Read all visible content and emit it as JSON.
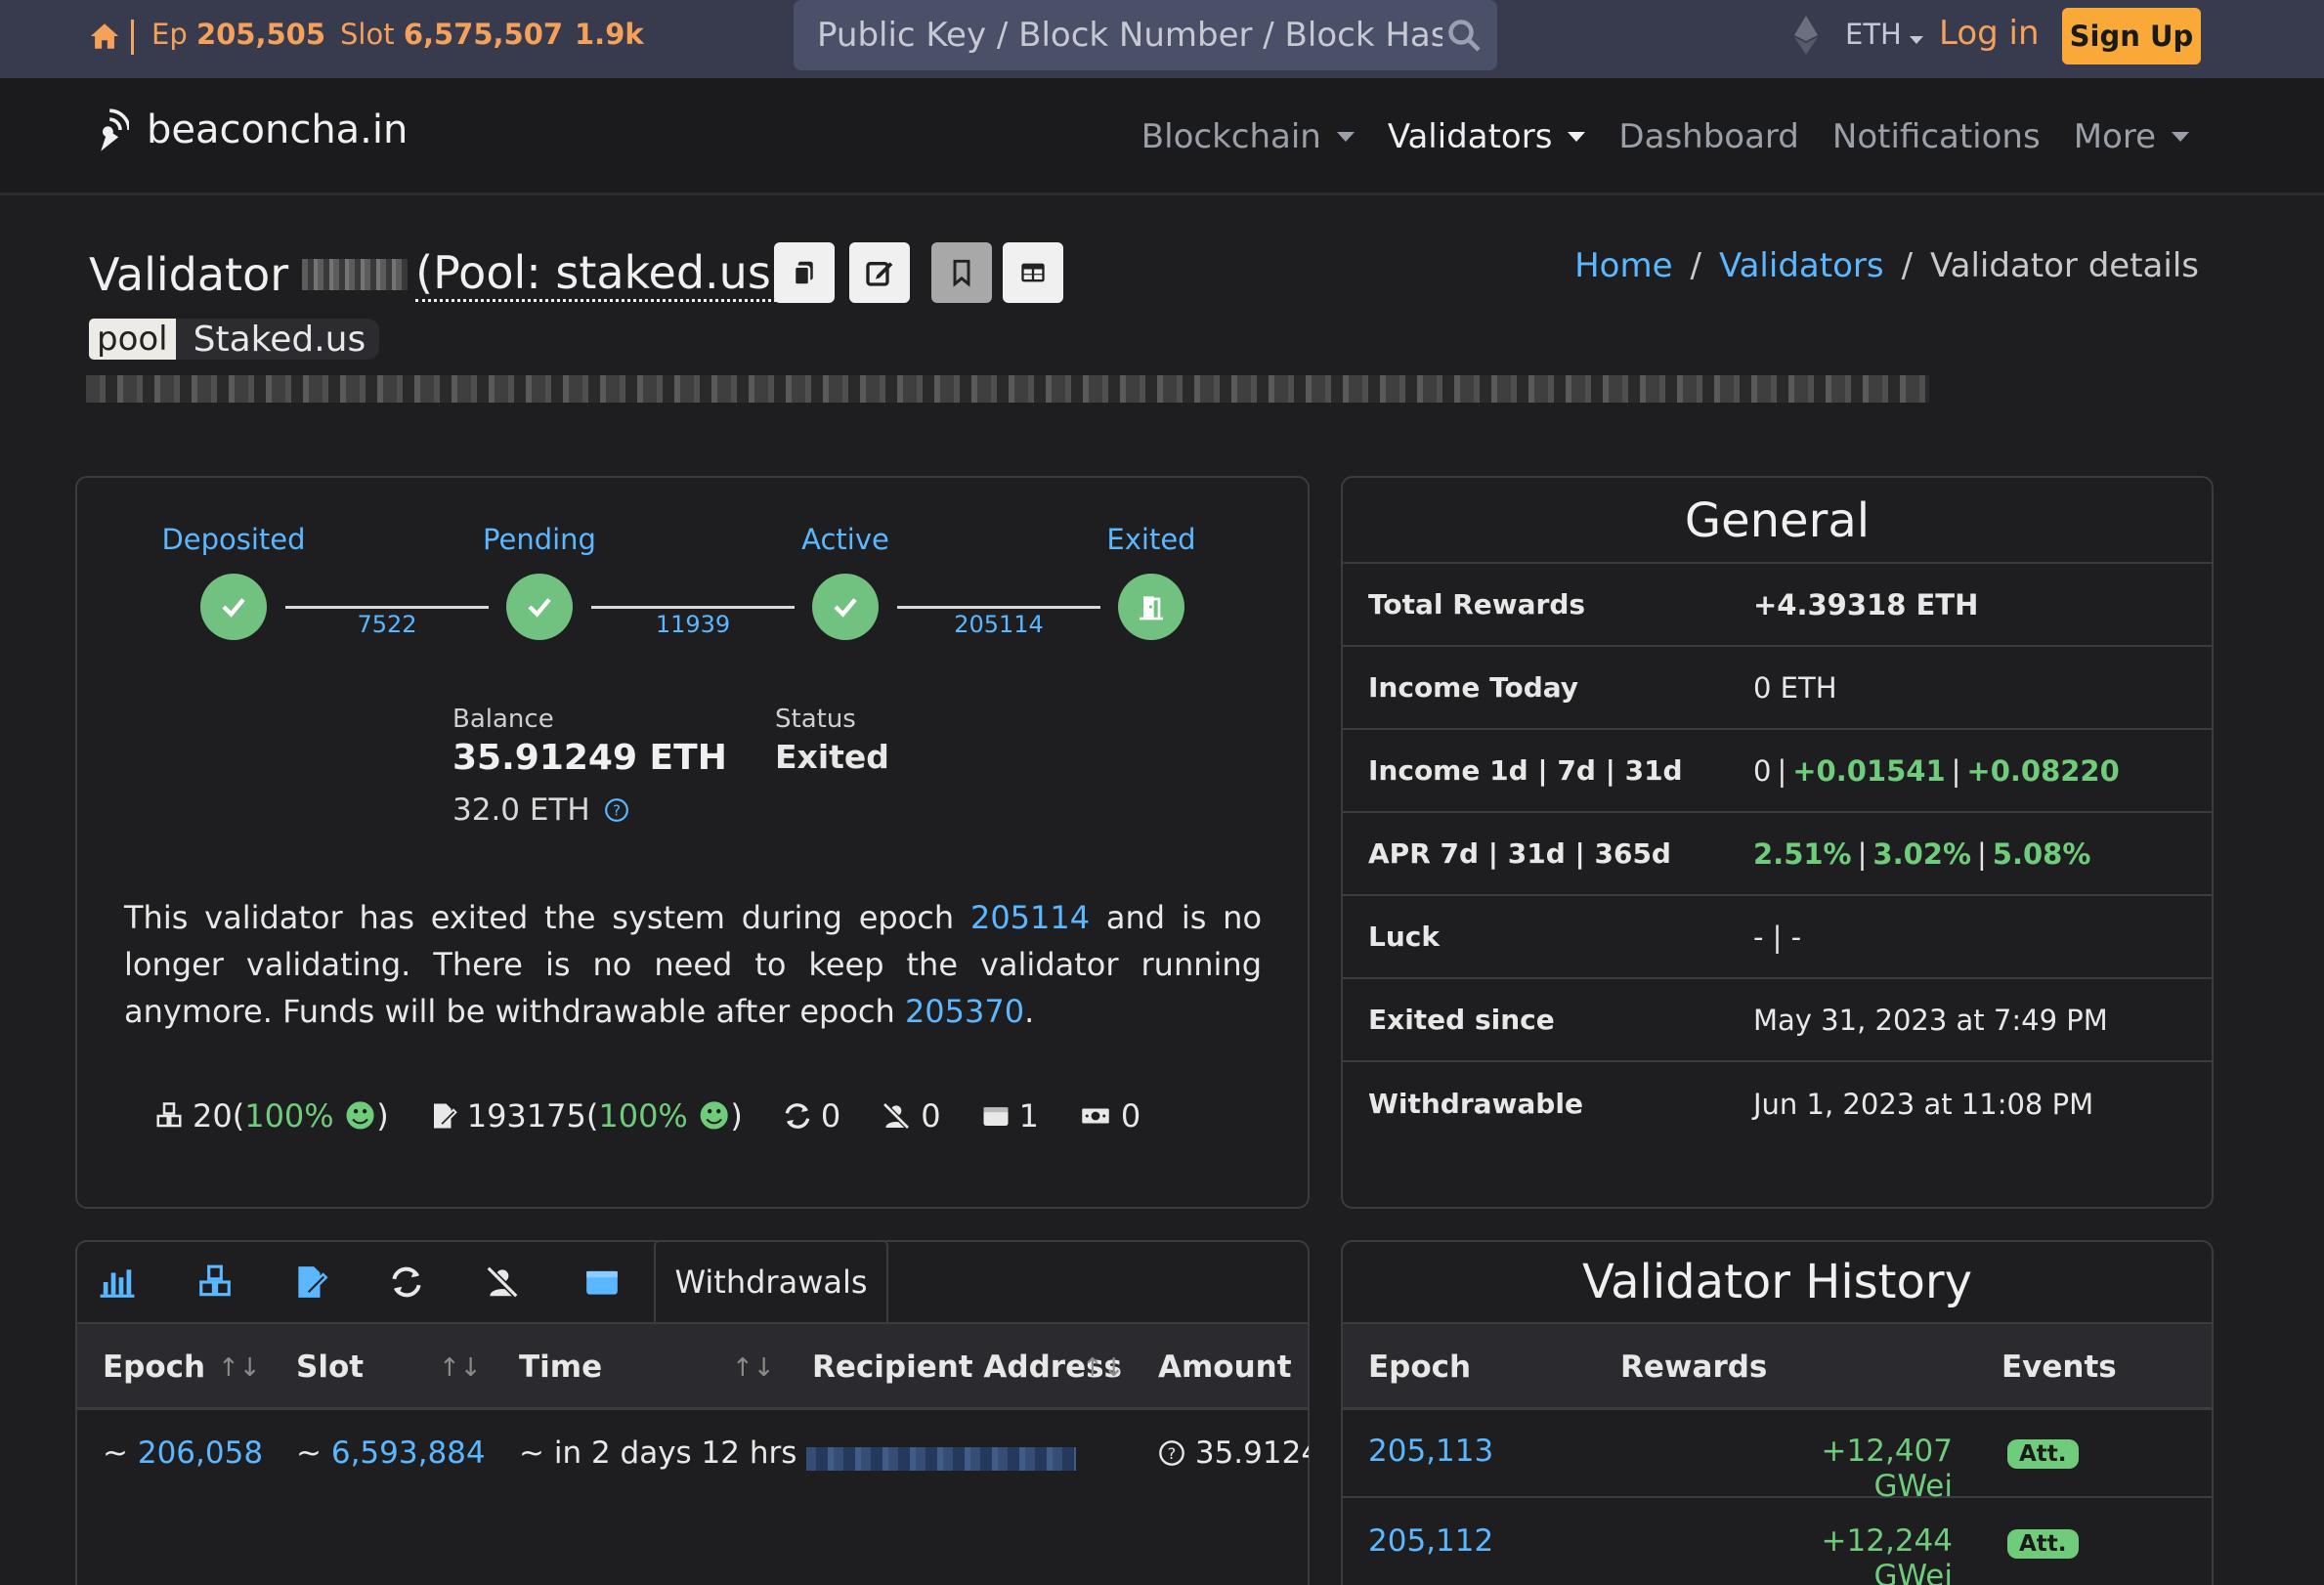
{
  "topbar": {
    "epoch_prefix": "Ep",
    "epoch": "205,505",
    "slot_prefix": "Slot",
    "slot": "6,575,507",
    "tps": "1.9k",
    "search_placeholder": "Public Key / Block Number / Block Hash / Graffiti",
    "currency": "ETH",
    "login": "Log in",
    "signup": "Sign Up"
  },
  "navbar": {
    "brand": "beaconcha.in",
    "items": [
      "Blockchain",
      "Validators",
      "Dashboard",
      "Notifications",
      "More"
    ]
  },
  "header": {
    "title_prefix": "Validator",
    "pool_label": "(Pool: staked.us)",
    "breadcrumb": [
      "Home",
      "Validators",
      "Validator details"
    ],
    "tag_key": "pool",
    "tag_value": "Staked.us"
  },
  "lifecycle": {
    "stages": [
      "Deposited",
      "Pending",
      "Active",
      "Exited"
    ],
    "transitions": [
      "7522",
      "11939",
      "205114"
    ],
    "balance_label": "Balance",
    "balance": "35.91249 ETH",
    "effective": "32.0 ETH",
    "status_label": "Status",
    "status": "Exited",
    "msg_1": "This validator has exited the system during epoch",
    "msg_exit_epoch": "205114",
    "msg_2": "and is no longer validating. There is no need to keep the validator running anymore. Funds will be withdrawable after epoch",
    "msg_withdraw_epoch": "205370",
    "msg_3": ".",
    "stats": {
      "proposals": "20",
      "proposals_pct": "100%",
      "attestations": "193175",
      "attestations_pct": "100%",
      "sync": "0",
      "slashings": "0",
      "deposits": "1",
      "withdrawals": "0"
    }
  },
  "general": {
    "title": "General",
    "rows": {
      "total_rewards_k": "Total Rewards",
      "total_rewards_v": "+4.39318 ETH",
      "income_today_k": "Income Today",
      "income_today_v": "0 ETH",
      "income_k": "Income 1d | 7d | 31d",
      "income_1d": "0",
      "income_7d": "+0.01541",
      "income_31d": "+0.08220",
      "apr_k": "APR 7d | 31d | 365d",
      "apr_7d": "2.51%",
      "apr_31d": "3.02%",
      "apr_365d": "5.08%",
      "luck_k": "Luck",
      "luck_v": "- | -",
      "exited_k": "Exited since",
      "exited_v": "May 31, 2023 at 7:49 PM",
      "withdrawable_k": "Withdrawable",
      "withdrawable_v": "Jun 1, 2023 at 11:08 PM"
    }
  },
  "withdrawals": {
    "tab_label": "Withdrawals",
    "columns": [
      "Epoch",
      "Slot",
      "Time",
      "Recipient Address",
      "Amount"
    ],
    "row": {
      "epoch": "206,058",
      "slot": "6,593,884",
      "time": "in 2 days 12 hrs",
      "amount": "35.9124"
    }
  },
  "history": {
    "title": "Validator History",
    "columns": [
      "Epoch",
      "Rewards",
      "Events"
    ],
    "rows": [
      {
        "epoch": "205,113",
        "rewards": "+12,407 GWei",
        "event": "Att."
      },
      {
        "epoch": "205,112",
        "rewards": "+12,244 GWei",
        "event": "Att."
      }
    ]
  },
  "colors": {
    "accent_orange": "#f6a15a",
    "link_blue": "#5bb7ff",
    "positive_green": "#6fcc7b",
    "signup_bg": "#f8a938"
  }
}
